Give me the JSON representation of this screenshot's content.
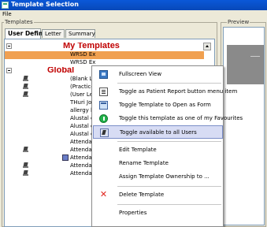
{
  "window": {
    "title": "Template Selection",
    "menu_file": "File"
  },
  "templates_group": {
    "label": "Templates"
  },
  "preview_group": {
    "label": "Preview"
  },
  "tabs": [
    "User Defined",
    "Letter",
    "Summary"
  ],
  "tree": {
    "my_templates": "My Templates",
    "my_items": [
      "WRSD Ex",
      "WRSD Ex"
    ],
    "global": "Global",
    "global_items": [
      "(Blank Let",
      "(Practice I",
      "(User Lett",
      "THuri Joh",
      "allergy lst",
      "Alustal orc",
      "Alustal orc",
      "Alustal orc",
      "Attendanc",
      "Attendanc",
      "Attendanc",
      "Attendanc",
      "Attendanc"
    ]
  },
  "context_menu": {
    "items": [
      {
        "label": "Fullscreen View",
        "icon": "fullscreen-icon"
      },
      {
        "label": "Toggle as Patient Report button menu item",
        "icon": "report-icon"
      },
      {
        "label": "Toggle Template to Open as Form",
        "icon": "form-icon"
      },
      {
        "label": "Toggle this template as one of my Favourites",
        "icon": "favourite-icon"
      },
      {
        "label": "Toggle available to all Users",
        "icon": "all-users-icon"
      },
      {
        "label": "Edit Template",
        "icon": ""
      },
      {
        "label": "Rename Template",
        "icon": ""
      },
      {
        "label": "Assign Template Ownership to ...",
        "icon": ""
      },
      {
        "label": "Delete Template",
        "icon": "delete-icon"
      },
      {
        "label": "Properties",
        "icon": ""
      }
    ]
  },
  "colors": {
    "heading": "#c00000",
    "selection": "#f0a050",
    "menu_highlight": "#d7dcf4",
    "titlebar": "#0a58d8"
  }
}
